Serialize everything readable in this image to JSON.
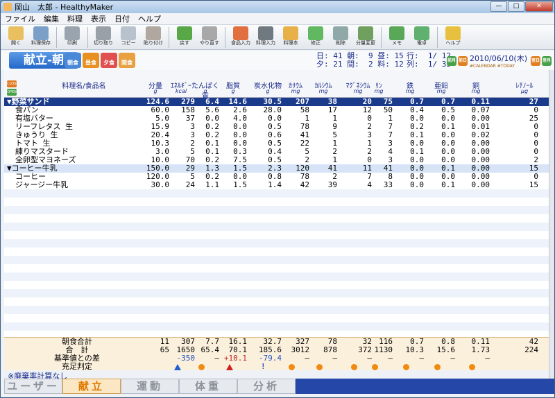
{
  "window": {
    "title": "岡山　太郎 - HealthyMaker",
    "min": "—",
    "max": "□",
    "close": "✕"
  },
  "menu": [
    "ファイル",
    "編集",
    "料理",
    "表示",
    "日付",
    "ヘルプ"
  ],
  "toolbar": [
    {
      "icon": "folder-open-icon",
      "label": "開く",
      "color": "#e8c060"
    },
    {
      "icon": "save-icon",
      "label": "料理保存",
      "color": "#7aa0c8"
    },
    {
      "icon": "printer-icon",
      "label": "印刷",
      "color": "#9aa4ae"
    },
    {
      "icon": "cut-icon",
      "label": "切り取り",
      "color": "#9aa0a8"
    },
    {
      "icon": "copy-icon",
      "label": "コピー",
      "color": "#b8c2cc"
    },
    {
      "icon": "paste-icon",
      "label": "貼り付け",
      "color": "#b0a8a0"
    },
    {
      "icon": "undo-icon",
      "label": "戻す",
      "color": "#58a848"
    },
    {
      "icon": "redo-icon",
      "label": "やり直す",
      "color": "#a8a8a8"
    },
    {
      "icon": "food-input-icon",
      "label": "食品入力",
      "color": "#e07040"
    },
    {
      "icon": "dish-input-icon",
      "label": "料理入力",
      "color": "#707880"
    },
    {
      "icon": "cook-book-icon",
      "label": "料理本",
      "color": "#e8b048"
    },
    {
      "icon": "diamond-edit-icon",
      "label": "修正",
      "color": "#60b860"
    },
    {
      "icon": "delete-icon",
      "label": "削除",
      "color": "#90a8a8"
    },
    {
      "icon": "scale-icon",
      "label": "分量変更",
      "color": "#70a060"
    },
    {
      "icon": "memo-icon",
      "label": "メモ",
      "color": "#58a858"
    },
    {
      "icon": "calculator-icon",
      "label": "電卓",
      "color": "#60b070"
    },
    {
      "icon": "help-icon",
      "label": "ヘルプ",
      "color": "#e8c040"
    }
  ],
  "meal": {
    "title": "献立-朝",
    "buttons": [
      {
        "label": "朝食",
        "color": "#4a88d8"
      },
      {
        "label": "昼食",
        "color": "#e89020"
      },
      {
        "label": "夕食",
        "color": "#e05050"
      },
      {
        "label": "間食",
        "color": "#e8a040"
      }
    ],
    "close_label": "CLOSE",
    "open_label": "OPEN"
  },
  "stats": {
    "line1": "日: 41 朝:  9 昼: 15",
    "line2": "夕: 21 間:  2 料: 12",
    "row_line": "行:  1/ 12",
    "col_line": "列:  1/ 33"
  },
  "date": {
    "value": "2010/06/10(木)",
    "calendar": "#CALENDAR",
    "today": "#TODAY",
    "prev_month": "前月",
    "prev_day": "前日",
    "next_day": "翌日",
    "next_month": "翌月"
  },
  "columns": [
    {
      "name": "料理名/食品名",
      "unit": ""
    },
    {
      "name": "分量",
      "unit": "g"
    },
    {
      "name": "ｴﾈﾙｷﾞｰ",
      "unit": "kcal"
    },
    {
      "name": "たんぱく質",
      "unit": "g"
    },
    {
      "name": "脂質",
      "unit": "g"
    },
    {
      "name": "炭水化物",
      "unit": "g"
    },
    {
      "name": "ｶﾘｳﾑ",
      "unit": "mg"
    },
    {
      "name": "ｶﾙｼｳﾑ",
      "unit": "mg"
    },
    {
      "name": "ﾏｸﾞﾈｼｳﾑ",
      "unit": "mg"
    },
    {
      "name": "ﾘﾝ",
      "unit": "mg"
    },
    {
      "name": "鉄",
      "unit": "mg"
    },
    {
      "name": "亜鉛",
      "unit": "mg"
    },
    {
      "name": "銅",
      "unit": "mg"
    },
    {
      "name": "ﾚﾁﾉｰﾙ",
      "unit": "μg"
    }
  ],
  "rows": [
    {
      "type": "grp1",
      "name": "▼野菜サンド",
      "values": [
        "124.6",
        "279",
        "6.4",
        "14.6",
        "30.5",
        "207",
        "38",
        "20",
        "75",
        "0.7",
        "0.7",
        "0.11",
        "27"
      ]
    },
    {
      "type": "item",
      "name": "食パン",
      "values": [
        "60.0",
        "158",
        "5.6",
        "2.6",
        "28.0",
        "58",
        "17",
        "12",
        "50",
        "0.4",
        "0.5",
        "0.07",
        "0"
      ]
    },
    {
      "type": "item",
      "name": "有塩バター",
      "values": [
        "5.0",
        "37",
        "0.0",
        "4.0",
        "0.0",
        "1",
        "1",
        "0",
        "1",
        "0.0",
        "0.0",
        "0.00",
        "25"
      ]
    },
    {
      "type": "item",
      "name": "リーフレタス 生",
      "values": [
        "15.9",
        "3",
        "0.2",
        "0.0",
        "0.5",
        "78",
        "9",
        "2",
        "7",
        "0.2",
        "0.1",
        "0.01",
        "0"
      ]
    },
    {
      "type": "item",
      "name": "きゅうり 生",
      "values": [
        "20.4",
        "3",
        "0.2",
        "0.0",
        "0.6",
        "41",
        "5",
        "3",
        "7",
        "0.1",
        "0.0",
        "0.02",
        "0"
      ]
    },
    {
      "type": "item",
      "name": "トマト 生",
      "values": [
        "10.3",
        "2",
        "0.1",
        "0.0",
        "0.5",
        "22",
        "1",
        "1",
        "3",
        "0.0",
        "0.0",
        "0.00",
        "0"
      ]
    },
    {
      "type": "item",
      "name": "練りマスタード",
      "values": [
        "3.0",
        "5",
        "0.1",
        "0.3",
        "0.4",
        "5",
        "2",
        "2",
        "4",
        "0.1",
        "0.0",
        "0.00",
        "0"
      ]
    },
    {
      "type": "item",
      "name": "全卵型マヨネーズ",
      "values": [
        "10.0",
        "70",
        "0.2",
        "7.5",
        "0.5",
        "2",
        "1",
        "0",
        "3",
        "0.0",
        "0.0",
        "0.00",
        "2"
      ]
    },
    {
      "type": "grp2",
      "name": "▼コーヒー牛乳",
      "values": [
        "150.0",
        "29",
        "1.3",
        "1.5",
        "2.3",
        "120",
        "41",
        "11",
        "41",
        "0.0",
        "0.1",
        "0.00",
        "15"
      ]
    },
    {
      "type": "item",
      "name": "コーヒー",
      "values": [
        "120.0",
        "5",
        "0.2",
        "0.0",
        "0.8",
        "78",
        "2",
        "7",
        "8",
        "0.0",
        "0.0",
        "0.00",
        "0"
      ]
    },
    {
      "type": "item",
      "name": "ジャージー牛乳",
      "values": [
        "30.0",
        "24",
        "1.1",
        "1.5",
        "1.4",
        "42",
        "39",
        "4",
        "33",
        "0.0",
        "0.1",
        "0.00",
        "15"
      ]
    }
  ],
  "totals": {
    "meal_label": "朝食合計",
    "meal_values": [
      "11",
      "307",
      "7.7",
      "16.1",
      "32.7",
      "327",
      "78",
      "32",
      "116",
      "0.7",
      "0.8",
      "0.11",
      "42"
    ],
    "total_label": "合　計",
    "total_values": [
      "65",
      "1650",
      "65.4",
      "70.1",
      "185.6",
      "3012",
      "878",
      "372",
      "1130",
      "10.3",
      "15.6",
      "1.73",
      "224"
    ],
    "diff_label": "基準値との差",
    "diff_values": [
      "",
      "-350",
      "—",
      "+10.1",
      "-79.4",
      "—",
      "—",
      "—",
      "—",
      "—",
      "—",
      "—",
      ""
    ],
    "judge_label": "充足判定",
    "judge_marks": [
      "",
      "up",
      "circ",
      "upr",
      "excl",
      "circ",
      "circ",
      "circ",
      "circ",
      "circ",
      "circ",
      "circ",
      ""
    ]
  },
  "note": "※廃棄率計算なし",
  "tabs": [
    {
      "label": "ユーザー",
      "active": false
    },
    {
      "label": "献立",
      "active": true
    },
    {
      "label": "運動",
      "active": false
    },
    {
      "label": "体重",
      "active": false
    },
    {
      "label": "分析",
      "active": false
    }
  ]
}
